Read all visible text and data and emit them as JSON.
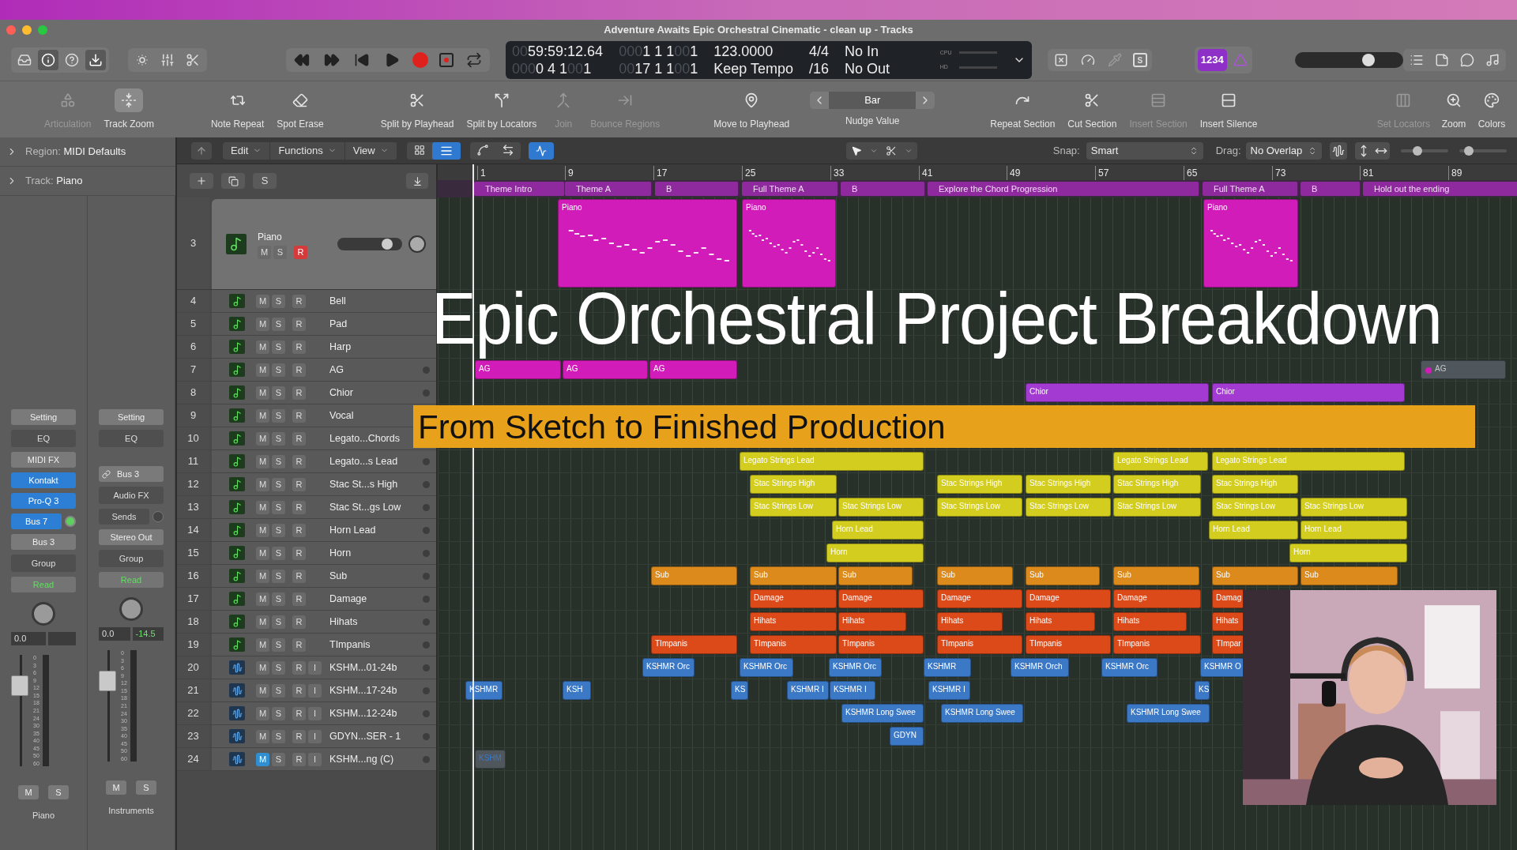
{
  "window": {
    "title": "Adventure Awaits Epic Orchestral Cinematic - clean up - Tracks"
  },
  "control_bar": {
    "lcd": [
      {
        "rows": [
          [
            {
              "text": "00",
              "dim": true
            },
            {
              "text": "59:59:12.64",
              "dim": false
            }
          ],
          [
            {
              "text": "000",
              "dim": true
            },
            {
              "text": "0 4 1",
              "dim": false
            },
            {
              "text": "00",
              "dim": true
            },
            {
              "text": "1",
              "dim": false
            }
          ]
        ]
      },
      {
        "rows": [
          [
            {
              "text": "000",
              "dim": true
            },
            {
              "text": "1 1 1",
              "dim": false
            },
            {
              "text": "00",
              "dim": true
            },
            {
              "text": "1",
              "dim": false
            }
          ],
          [
            {
              "text": "00",
              "dim": true
            },
            {
              "text": "17 1 1",
              "dim": false
            },
            {
              "text": "00",
              "dim": true
            },
            {
              "text": "1",
              "dim": false
            }
          ]
        ]
      },
      {
        "rows": [
          [
            {
              "text": "123.0000",
              "dim": false
            }
          ],
          [
            {
              "text": "Keep Tempo",
              "dim": false
            }
          ]
        ]
      },
      {
        "rows": [
          [
            {
              "text": "4/4",
              "dim": false
            }
          ],
          [
            {
              "text": "/16",
              "dim": false
            }
          ]
        ]
      },
      {
        "rows": [
          [
            {
              "text": "No In",
              "dim": false
            }
          ],
          [
            {
              "text": "No Out",
              "dim": false
            }
          ]
        ]
      }
    ],
    "meters": [
      "CPU",
      "HD"
    ],
    "solo_key": "S",
    "count_in": {
      "label": "1234",
      "on": true
    },
    "master_volume": {
      "level": 0.68
    }
  },
  "toolbar": {
    "items": [
      {
        "kind": "tool",
        "label": "Articulation",
        "disabled": true,
        "on": false
      },
      {
        "kind": "tool",
        "label": "Track Zoom",
        "disabled": false,
        "on": true
      },
      {
        "kind": "tool",
        "label": "Note Repeat",
        "disabled": false,
        "on": false
      },
      {
        "kind": "tool",
        "label": "Spot Erase",
        "disabled": false,
        "on": false
      },
      {
        "kind": "tool",
        "label": "Split by Playhead",
        "disabled": false,
        "on": false
      },
      {
        "kind": "tool",
        "label": "Split by Locators",
        "disabled": false,
        "on": false
      },
      {
        "kind": "tool",
        "label": "Join",
        "disabled": true,
        "on": false
      },
      {
        "kind": "tool",
        "label": "Bounce Regions",
        "disabled": true,
        "on": false
      },
      {
        "kind": "tool",
        "label": "Move to Playhead",
        "disabled": false,
        "on": false
      },
      {
        "kind": "nudge",
        "label": "Nudge Value",
        "value": "Bar"
      },
      {
        "kind": "tool",
        "label": "Repeat Section",
        "disabled": false,
        "on": false
      },
      {
        "kind": "tool",
        "label": "Cut Section",
        "disabled": false,
        "on": false
      },
      {
        "kind": "tool",
        "label": "Insert Section",
        "disabled": true,
        "on": false
      },
      {
        "kind": "tool",
        "label": "Insert Silence",
        "disabled": false,
        "on": false
      },
      {
        "kind": "tool",
        "label": "Set Locators",
        "disabled": true,
        "on": false
      },
      {
        "kind": "tool",
        "label": "Zoom",
        "disabled": false,
        "on": false
      },
      {
        "kind": "tool",
        "label": "Colors",
        "disabled": false,
        "on": false
      }
    ]
  },
  "inspector": {
    "region": {
      "label": "Region:",
      "value": "MIDI Defaults"
    },
    "track": {
      "label": "Track:",
      "value": "Piano"
    }
  },
  "mixer": {
    "strips": [
      {
        "name": "Piano",
        "items": [
          {
            "kind": "button",
            "label": "Setting"
          },
          {
            "kind": "slot",
            "label": "EQ"
          },
          {
            "kind": "button",
            "label": "MIDI FX"
          },
          {
            "kind": "plugin",
            "label": "Kontakt"
          },
          {
            "kind": "plugin",
            "label": "Pro-Q 3"
          },
          {
            "kind": "send",
            "label": "Bus 7"
          },
          {
            "kind": "button",
            "label": "Bus 3"
          },
          {
            "kind": "slot",
            "label": "Group"
          },
          {
            "kind": "automation",
            "label": "Read"
          }
        ],
        "volume": "0.0",
        "fader": {
          "level": 0.72
        },
        "scale": [
          "0",
          "3",
          "6",
          "9",
          "12",
          "15",
          "18",
          "21",
          "24",
          "30",
          "35",
          "40",
          "45",
          "50",
          "60"
        ],
        "mute": "M",
        "solo": "S"
      },
      {
        "name": "Instruments",
        "items": [
          {
            "kind": "button",
            "label": "Setting"
          },
          {
            "kind": "slot",
            "label": "EQ"
          },
          {
            "kind": "input",
            "label": "Bus 3"
          },
          {
            "kind": "slot",
            "label": "Audio FX"
          },
          {
            "kind": "sends",
            "label": "Sends"
          },
          {
            "kind": "button",
            "label": "Stereo Out"
          },
          {
            "kind": "slot",
            "label": "Group"
          },
          {
            "kind": "automation",
            "label": "Read"
          }
        ],
        "volume": "0.0",
        "peak": "-14.5",
        "fader": {
          "level": 0.72
        },
        "scale": [
          "0",
          "3",
          "6",
          "9",
          "12",
          "15",
          "18",
          "21",
          "24",
          "30",
          "35",
          "40",
          "45",
          "50",
          "60"
        ],
        "mute": "M",
        "solo": "S"
      }
    ]
  },
  "edit_bar": {
    "menus": [
      "Edit",
      "Functions",
      "View"
    ],
    "snap": {
      "label": "Snap:",
      "value": "Smart"
    },
    "drag": {
      "label": "Drag:",
      "value": "No Overlap"
    },
    "zoom_sliders": [
      {
        "level": 0.35
      },
      {
        "level": 0.2
      }
    ]
  },
  "track_tools": {
    "solo_button": "S"
  },
  "ruler": {
    "bars": [
      "1",
      "9",
      "17",
      "25",
      "33",
      "41",
      "49",
      "57",
      "65",
      "73",
      "81",
      "89"
    ]
  },
  "arrangement": [
    {
      "label": "Theme Intro"
    },
    {
      "label": "Theme A"
    },
    {
      "label": "B"
    },
    {
      "label": "Full Theme A"
    },
    {
      "label": "B"
    },
    {
      "label": "Explore the Chord Progression"
    },
    {
      "label": "Full Theme A"
    },
    {
      "label": "B"
    },
    {
      "label": "Hold out the ending"
    }
  ],
  "tracks": [
    {
      "number": "3",
      "name": "Piano",
      "kind": "midi",
      "color": "#d21cba",
      "selected": true,
      "muted": false,
      "armed": true,
      "mute": "M",
      "solo": "S",
      "rec": "R",
      "regions": [
        {
          "label": "Piano"
        },
        {
          "label": "Piano"
        },
        {
          "label": "Piano"
        }
      ]
    },
    {
      "number": "4",
      "name": "Bell",
      "kind": "midi",
      "selected": false,
      "muted": false,
      "armed": false,
      "mute": "M",
      "solo": "S",
      "rec": "R"
    },
    {
      "number": "5",
      "name": "Pad",
      "kind": "midi",
      "selected": false,
      "muted": false,
      "armed": false,
      "mute": "M",
      "solo": "S",
      "rec": "R"
    },
    {
      "number": "6",
      "name": "Harp",
      "kind": "midi",
      "selected": false,
      "muted": false,
      "armed": false,
      "mute": "M",
      "solo": "S",
      "rec": "R"
    },
    {
      "number": "7",
      "name": "AG",
      "kind": "midi",
      "color": "#d21cba",
      "selected": false,
      "muted": false,
      "armed": false,
      "mute": "M",
      "solo": "S",
      "rec": "R",
      "regions": [
        {
          "label": "AG",
          "muted": false
        },
        {
          "label": "AG",
          "muted": false
        },
        {
          "label": "AG",
          "muted": false
        },
        {
          "label": "AG",
          "muted": true
        }
      ]
    },
    {
      "number": "8",
      "name": "Chior",
      "kind": "midi",
      "color": "#a33ad2",
      "selected": false,
      "muted": false,
      "armed": false,
      "mute": "M",
      "solo": "S",
      "rec": "R",
      "regions": [
        {
          "label": "Chior"
        },
        {
          "label": "Chior"
        }
      ]
    },
    {
      "number": "9",
      "name": "Vocal",
      "kind": "midi",
      "selected": false,
      "muted": false,
      "armed": false,
      "mute": "M",
      "solo": "S",
      "rec": "R"
    },
    {
      "number": "10",
      "name": "Legato...Chords",
      "kind": "midi",
      "selected": false,
      "muted": false,
      "armed": false,
      "mute": "M",
      "solo": "S",
      "rec": "R"
    },
    {
      "number": "11",
      "name": "Legato...s Lead",
      "kind": "midi",
      "color": "#d3cd1f",
      "selected": false,
      "muted": false,
      "armed": false,
      "mute": "M",
      "solo": "S",
      "rec": "R",
      "regions": [
        {
          "label": "Legato Strings Lead"
        },
        {
          "label": "Legato Strings Lead"
        },
        {
          "label": "Legato Strings Lead"
        }
      ]
    },
    {
      "number": "12",
      "name": "Stac St...s High",
      "kind": "midi",
      "color": "#d3cd1f",
      "selected": false,
      "muted": false,
      "armed": false,
      "mute": "M",
      "solo": "S",
      "rec": "R",
      "regions": [
        {
          "label": "Stac Strings High"
        },
        {
          "label": "Stac Strings High"
        },
        {
          "label": "Stac Strings High"
        },
        {
          "label": "Stac Strings High"
        },
        {
          "label": "Stac Strings High"
        }
      ]
    },
    {
      "number": "13",
      "name": "Stac St...gs Low",
      "kind": "midi",
      "color": "#d3cd1f",
      "selected": false,
      "muted": false,
      "armed": false,
      "mute": "M",
      "solo": "S",
      "rec": "R",
      "regions": [
        {
          "label": "Stac Strings Low"
        },
        {
          "label": "Stac Strings Low"
        },
        {
          "label": "Stac Strings Low"
        },
        {
          "label": "Stac Strings Low"
        },
        {
          "label": "Stac Strings Low"
        },
        {
          "label": "Stac Strings Low"
        },
        {
          "label": "Stac Strings Low"
        }
      ]
    },
    {
      "number": "14",
      "name": "Horn Lead",
      "kind": "midi",
      "color": "#d3cd1f",
      "selected": false,
      "muted": false,
      "armed": false,
      "mute": "M",
      "solo": "S",
      "rec": "R",
      "regions": [
        {
          "label": "Horn Lead"
        },
        {
          "label": "Horn Lead"
        },
        {
          "label": "Horn Lead"
        }
      ]
    },
    {
      "number": "15",
      "name": "Horn",
      "kind": "midi",
      "color": "#d3cd1f",
      "selected": false,
      "muted": false,
      "armed": false,
      "mute": "M",
      "solo": "S",
      "rec": "R",
      "regions": [
        {
          "label": "Horn"
        },
        {
          "label": "Horn"
        }
      ]
    },
    {
      "number": "16",
      "name": "Sub",
      "kind": "midi",
      "color": "#dd8a1c",
      "selected": false,
      "muted": false,
      "armed": false,
      "mute": "M",
      "solo": "S",
      "rec": "R",
      "regions": [
        {
          "label": "Sub"
        },
        {
          "label": "Sub"
        },
        {
          "label": "Sub"
        },
        {
          "label": "Sub"
        },
        {
          "label": "Sub"
        },
        {
          "label": "Sub"
        },
        {
          "label": "Sub"
        },
        {
          "label": "Sub"
        }
      ]
    },
    {
      "number": "17",
      "name": "Damage",
      "kind": "midi",
      "color": "#dc4a1a",
      "selected": false,
      "muted": false,
      "armed": false,
      "mute": "M",
      "solo": "S",
      "rec": "R",
      "regions": [
        {
          "label": "Damage"
        },
        {
          "label": "Damage"
        },
        {
          "label": "Damage"
        },
        {
          "label": "Damage"
        },
        {
          "label": "Damage"
        },
        {
          "label": "Damag"
        }
      ]
    },
    {
      "number": "18",
      "name": "Hihats",
      "kind": "midi",
      "color": "#dc4a1a",
      "selected": false,
      "muted": false,
      "armed": false,
      "mute": "M",
      "solo": "S",
      "rec": "R",
      "regions": [
        {
          "label": "Hihats"
        },
        {
          "label": "Hihats"
        },
        {
          "label": "Hihats"
        },
        {
          "label": "Hihats"
        },
        {
          "label": "Hihats"
        },
        {
          "label": "Hihats"
        }
      ]
    },
    {
      "number": "19",
      "name": "TImpanis",
      "kind": "midi",
      "color": "#dc4a1a",
      "selected": false,
      "muted": false,
      "armed": false,
      "mute": "M",
      "solo": "S",
      "rec": "R",
      "regions": [
        {
          "label": "TImpanis"
        },
        {
          "label": "TImpanis"
        },
        {
          "label": "TImpanis"
        },
        {
          "label": "TImpanis"
        },
        {
          "label": "TImpanis"
        },
        {
          "label": "TImpanis"
        },
        {
          "label": "TImpar"
        }
      ]
    },
    {
      "number": "20",
      "name": "KSHM...01-24b",
      "kind": "audio",
      "color": "#3b78c6",
      "selected": false,
      "muted": false,
      "armed": false,
      "mute": "M",
      "solo": "S",
      "rec": "R",
      "input": "I",
      "regions": [
        {
          "label": "KSHMR Orc"
        },
        {
          "label": "KSHMR Orc"
        },
        {
          "label": "KSHMR Orc"
        },
        {
          "label": "KSHMR"
        },
        {
          "label": "KSHMR Orch"
        },
        {
          "label": "KSHMR Orc"
        },
        {
          "label": "KSHMR O"
        }
      ]
    },
    {
      "number": "21",
      "name": "KSHM...17-24b",
      "kind": "audio",
      "color": "#3b78c6",
      "selected": false,
      "muted": false,
      "armed": false,
      "mute": "M",
      "solo": "S",
      "rec": "R",
      "input": "I",
      "regions": [
        {
          "label": "KSHMR"
        },
        {
          "label": "KSH"
        },
        {
          "label": "KS"
        },
        {
          "label": "KSHMR I"
        },
        {
          "label": "KSHMR I"
        },
        {
          "label": "KSHMR I"
        },
        {
          "label": "KS"
        }
      ]
    },
    {
      "number": "22",
      "name": "KSHM...12-24b",
      "kind": "audio",
      "color": "#3b78c6",
      "selected": false,
      "muted": false,
      "armed": false,
      "mute": "M",
      "solo": "S",
      "rec": "R",
      "input": "I",
      "regions": [
        {
          "label": "KSHMR Long Swee"
        },
        {
          "label": "KSHMR Long Swee"
        },
        {
          "label": "KSHMR Long Swee"
        }
      ]
    },
    {
      "number": "23",
      "name": "GDYN...SER - 1",
      "kind": "audio",
      "color": "#3b78c6",
      "selected": false,
      "muted": false,
      "armed": false,
      "mute": "M",
      "solo": "S",
      "rec": "R",
      "input": "I",
      "regions": [
        {
          "label": "GDYN"
        }
      ]
    },
    {
      "number": "24",
      "name": "KSHM...ng (C)",
      "kind": "audio",
      "color": "#3b78c6",
      "selected": false,
      "muted": true,
      "armed": false,
      "mute": "M",
      "solo": "S",
      "rec": "R",
      "input": "I",
      "regions": [
        {
          "label": "KSHM"
        }
      ]
    }
  ],
  "overlay": {
    "title": "Epic Orchestral Project Breakdown",
    "subtitle": "From Sketch to Finished Production"
  }
}
